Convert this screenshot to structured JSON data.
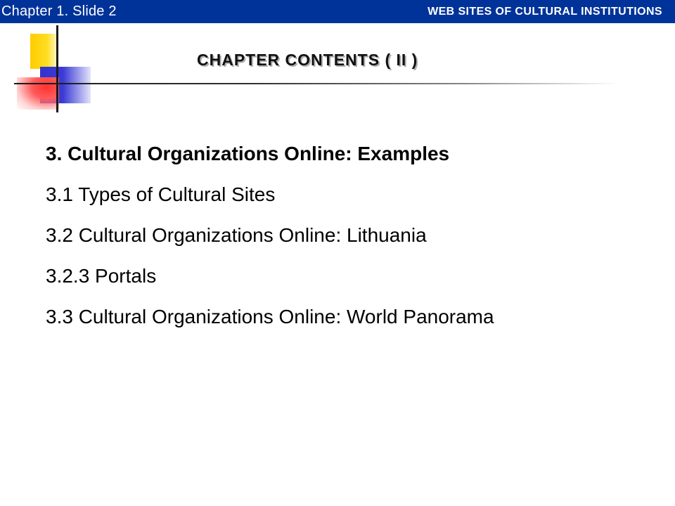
{
  "header": {
    "slide_label": "Chapter 1. Slide 2",
    "title": "WEB SITES OF CULTURAL INSTITUTIONS",
    "bar_color": "#003399"
  },
  "logo": {
    "colors": {
      "yellow": "#ffcc00",
      "blue": "#3333cc",
      "red": "#ff3333",
      "line": "#1a1a1a"
    }
  },
  "slide": {
    "title": "CHAPTER CONTENTS ( II )",
    "items": [
      "3. Cultural Organizations Online: Examples",
      "3.1 Types of Cultural Sites",
      "3.2 Cultural Organizations Online: Lithuania",
      "3.2.3 Portals",
      "3.3 Cultural Organizations Online: World Panorama"
    ]
  }
}
